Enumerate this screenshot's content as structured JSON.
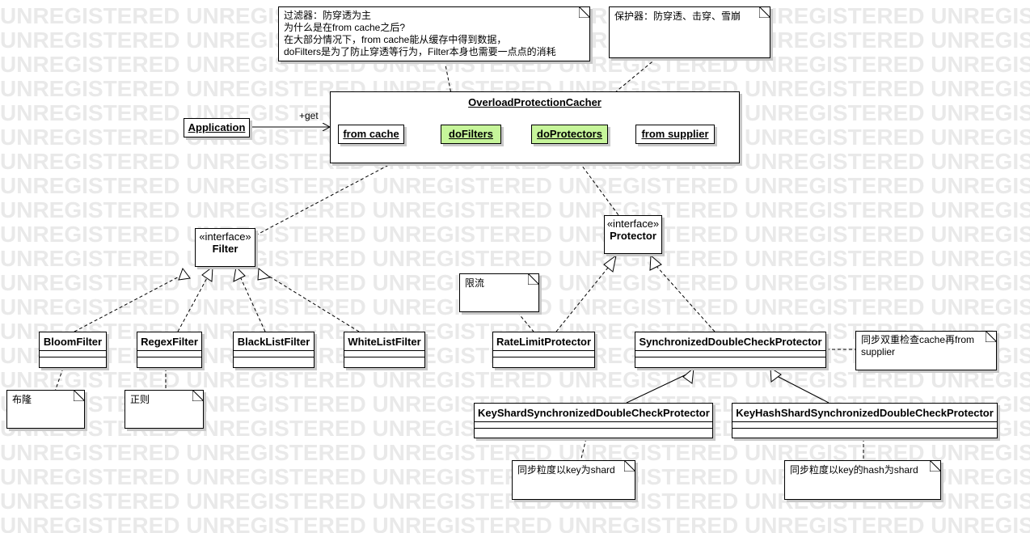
{
  "watermark": "UNREGISTERED",
  "cacher": {
    "title": "OverloadProtectionCacher"
  },
  "application": {
    "label": "Application"
  },
  "get_label": "+get",
  "flow": {
    "from_cache": "from cache",
    "do_filters": "doFilters",
    "do_protectors": "doProtectors",
    "from_supplier": "from supplier"
  },
  "notes": {
    "filter_note": [
      "过滤器：防穿透为主",
      "为什么是在from cache之后?",
      "在大部分情况下，from cache能从缓存中得到数据，",
      "doFilters是为了防止穿透等行为，Filter本身也需要一点点的消耗"
    ],
    "protector_note": "保护器：防穿透、击穿、雪崩",
    "bloom_note": "布隆",
    "regex_note": "正则",
    "ratelimit_note": "限流",
    "sync_note": [
      "同步双重检查cache再from",
      "supplier"
    ],
    "keyshard_note": "同步粒度以key为shard",
    "keyhash_note": "同步粒度以key的hash为shard"
  },
  "interfaces": {
    "stereotype": "«interface»",
    "filter": "Filter",
    "protector": "Protector"
  },
  "classes": {
    "bloom": "BloomFilter",
    "regex": "RegexFilter",
    "blacklist": "BlackListFilter",
    "whitelist": "WhiteListFilter",
    "ratelimit": "RateLimitProtector",
    "sync": "SynchronizedDoubleCheckProtector",
    "keyshard": "KeyShardSynchronizedDoubleCheckProtector",
    "keyhash": "KeyHashShardSynchronizedDoubleCheckProtector"
  },
  "colors": {
    "highlight": "#c6f59a",
    "watermark": "#e9e9e9",
    "shadow": "#c8c8c8"
  }
}
